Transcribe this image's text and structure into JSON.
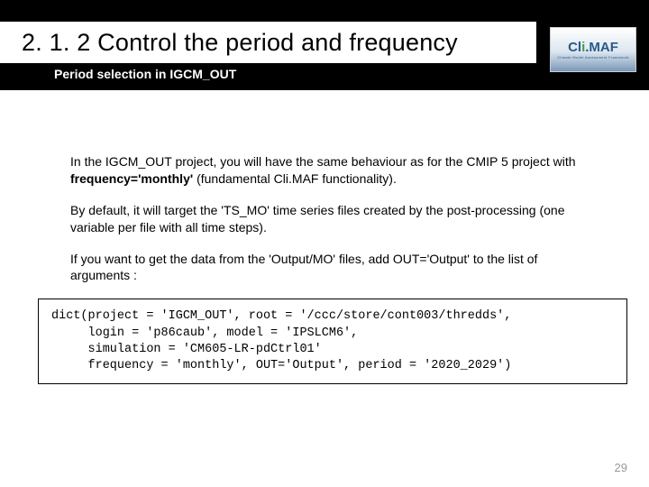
{
  "header": {
    "title": "2. 1. 2 Control the period and frequency",
    "subtitle": "Period selection in IGCM_OUT"
  },
  "logo": {
    "name_pre": "Cl",
    "name_i": "i",
    "name_post": ".MAF",
    "tagline": "Climate Model Assessment Framework"
  },
  "body": {
    "p1_a": "In the IGCM_OUT project, you will have the same behaviour as for the CMIP 5 project with ",
    "p1_b": "frequency='monthly'",
    "p1_c": " (fundamental Cli.MAF functionality).",
    "p2": "By default, it will target the 'TS_MO' time series files created by the post-processing (one variable per file with all time steps).",
    "p3": "If you want to get the data from the 'Output/MO' files, add OUT='Output' to the list of arguments :"
  },
  "code": "dict(project = 'IGCM_OUT', root = '/ccc/store/cont003/thredds',\n     login = 'p86caub', model = 'IPSLCM6',\n     simulation = 'CM605-LR-pdCtrl01'\n     frequency = 'monthly', OUT='Output', period = '2020_2029')",
  "page_number": "29"
}
